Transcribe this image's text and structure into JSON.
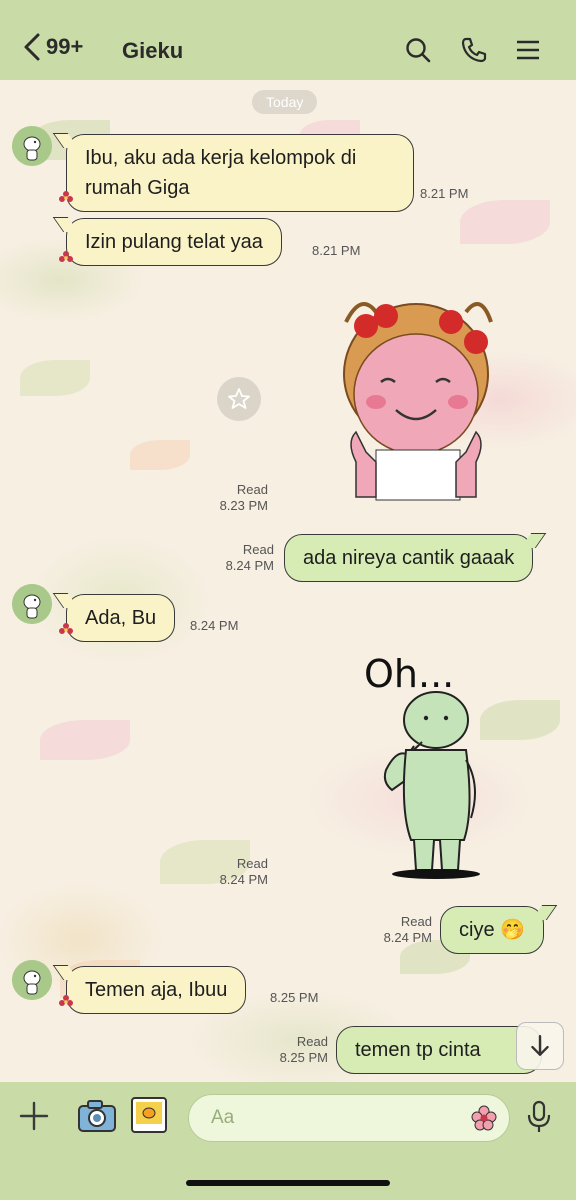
{
  "header": {
    "back_count": "99+",
    "title": "Gieku",
    "icons": [
      "chevron-left-icon",
      "search-icon",
      "phone-icon",
      "menu-icon"
    ]
  },
  "date_chip": "Today",
  "messages": [
    {
      "side": "in",
      "text_line1": "Ibu, aku ada kerja kelompok di",
      "text_line2": "rumah Giga",
      "time": "8.21 PM"
    },
    {
      "side": "in",
      "text": "Izin pulang telat yaa",
      "time": "8.21 PM"
    },
    {
      "side": "in",
      "type": "sticker",
      "sticker": "girl-thumbs-up-sticker"
    },
    {
      "side": "out",
      "read": "Read",
      "time": "8.23 PM"
    },
    {
      "side": "out",
      "text": "ada nireya cantik gaaak",
      "read": "Read",
      "time": "8.24 PM"
    },
    {
      "side": "in",
      "text": "Ada, Bu",
      "time": "8.24 PM"
    },
    {
      "side": "out",
      "type": "sticker",
      "sticker_text": "Oh...",
      "read": "Read",
      "time": "8.24 PM"
    },
    {
      "side": "out",
      "text": "ciye 🤭",
      "read": "Read",
      "time": "8.24 PM"
    },
    {
      "side": "in",
      "text": "Temen aja, Ibuu",
      "time": "8.25 PM"
    },
    {
      "side": "out",
      "text": "temen tp cinta",
      "read": "Read",
      "time": "8.25 PM"
    }
  ],
  "input": {
    "placeholder": "Aa"
  },
  "colors": {
    "header": "#c9dca7",
    "incoming": "#fbf3c8",
    "outgoing": "#d6ecb4"
  }
}
